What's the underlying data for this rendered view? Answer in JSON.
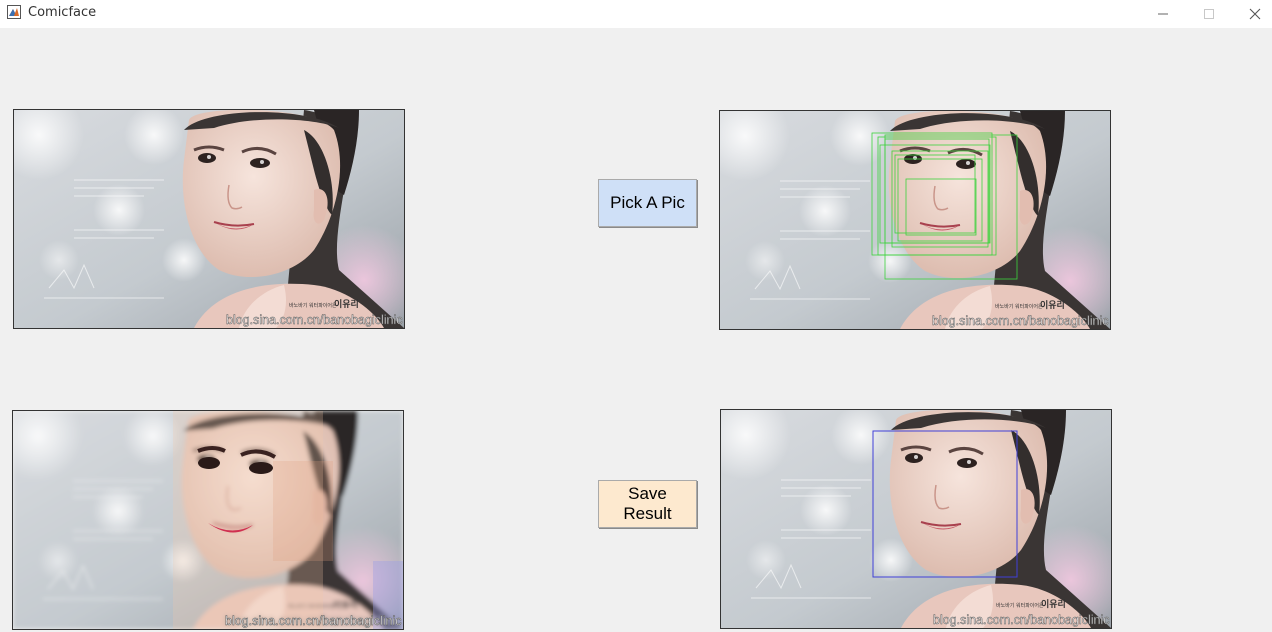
{
  "window": {
    "title": "Comicface",
    "icons": {
      "app": "matlab-icon",
      "minimize": "minimize-icon",
      "maximize": "maximize-icon",
      "close": "close-icon"
    }
  },
  "buttons": {
    "pick_label": "Pick A Pic",
    "save_label": "Save Result"
  },
  "photo": {
    "caption": "이유리",
    "caption_small": "바노바기 워터파이어은",
    "watermark": "blog.sina.com.cn/banobagiclinic"
  },
  "colors": {
    "pick_button_bg": "#cfe0f7",
    "save_button_bg": "#fde9cf",
    "detection_green": "#3cd23c",
    "detection_blue": "#4040d8"
  }
}
